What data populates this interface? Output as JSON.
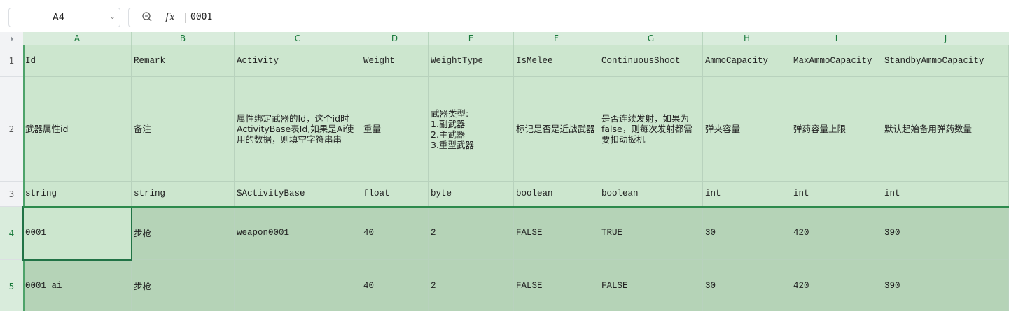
{
  "formula_bar": {
    "cell_ref": "A4",
    "fx_label": "fx",
    "formula_value": "0001"
  },
  "columns": [
    "A",
    "B",
    "C",
    "D",
    "E",
    "F",
    "G",
    "H",
    "I",
    "J"
  ],
  "rows": [
    {
      "num": "1",
      "cells": [
        "Id",
        "Remark",
        "Activity",
        "Weight",
        "WeightType",
        "IsMelee",
        "ContinuousShoot",
        "AmmoCapacity",
        "MaxAmmoCapacity",
        "StandbyAmmoCapacity"
      ]
    },
    {
      "num": "2",
      "cells": [
        "武器属性id",
        "备注",
        "属性绑定武器的Id，这个id时ActivityBase表Id,如果是Ai使用的数据，则填空字符串串",
        "重量",
        "武器类型:\n1.副武器\n2.主武器\n3.重型武器",
        "标记是否是近战武器",
        "是否连续发射，如果为false，则每次发射都需要扣动扳机",
        "弹夹容量",
        "弹药容量上限",
        "默认起始备用弹药数量"
      ]
    },
    {
      "num": "3",
      "cells": [
        "string",
        "string",
        "$ActivityBase",
        "float",
        "byte",
        "boolean",
        "boolean",
        "int",
        "int",
        "int"
      ]
    },
    {
      "num": "4",
      "cells": [
        "0001",
        "步枪",
        "weapon0001",
        "40",
        "2",
        "FALSE",
        "TRUE",
        "30",
        "420",
        "390"
      ]
    },
    {
      "num": "5",
      "cells": [
        "0001_ai",
        "步枪",
        "",
        "40",
        "2",
        "FALSE",
        "FALSE",
        "30",
        "420",
        "390"
      ]
    }
  ]
}
